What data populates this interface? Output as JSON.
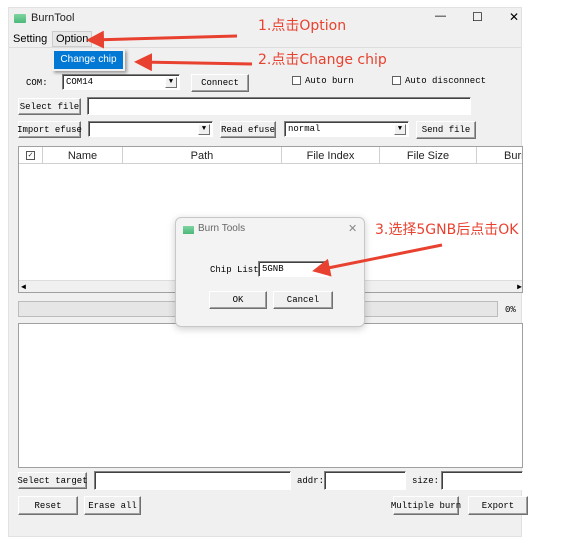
{
  "window": {
    "title": "BurnTool",
    "minimize": "—",
    "maximize": "☐",
    "close": "✕"
  },
  "menu": {
    "items": [
      {
        "label": "Setting"
      },
      {
        "label": "Option"
      }
    ],
    "dropdown": [
      {
        "label": "Change chip"
      }
    ]
  },
  "com": {
    "label": "COM:",
    "value": "COM14",
    "connect": "Connect",
    "auto_burn": "Auto burn",
    "auto_disconnect": "Auto disconnect"
  },
  "file": {
    "select_file": "Select file",
    "path": ""
  },
  "efuse": {
    "import": "Import efuse",
    "value": "",
    "read": "Read efuse",
    "mode": "normal",
    "send_file": "Send file"
  },
  "table": {
    "columns": [
      "Name",
      "Path",
      "File Index",
      "File Size",
      "Burn"
    ]
  },
  "progress": {
    "percent": 0,
    "label": "0%"
  },
  "target": {
    "select_target": "Select target",
    "addr_label": "addr:",
    "size_label": "size:"
  },
  "buttons": {
    "reset": "Reset",
    "erase_all": "Erase all",
    "multiple_burn": "Multiple burn",
    "export": "Export"
  },
  "dialog": {
    "title": "Burn Tools",
    "close": "✕",
    "chip_list_label": "Chip List",
    "chip_value": "5GNB",
    "ok": "OK",
    "cancel": "Cancel"
  },
  "annotations": {
    "step1": "1.点击Option",
    "step2": "2.点击Change chip",
    "step3": "3.选择5GNB后点击OK",
    "color": "#e8412f"
  },
  "colors": {
    "menu_highlight": "#0078d4"
  }
}
